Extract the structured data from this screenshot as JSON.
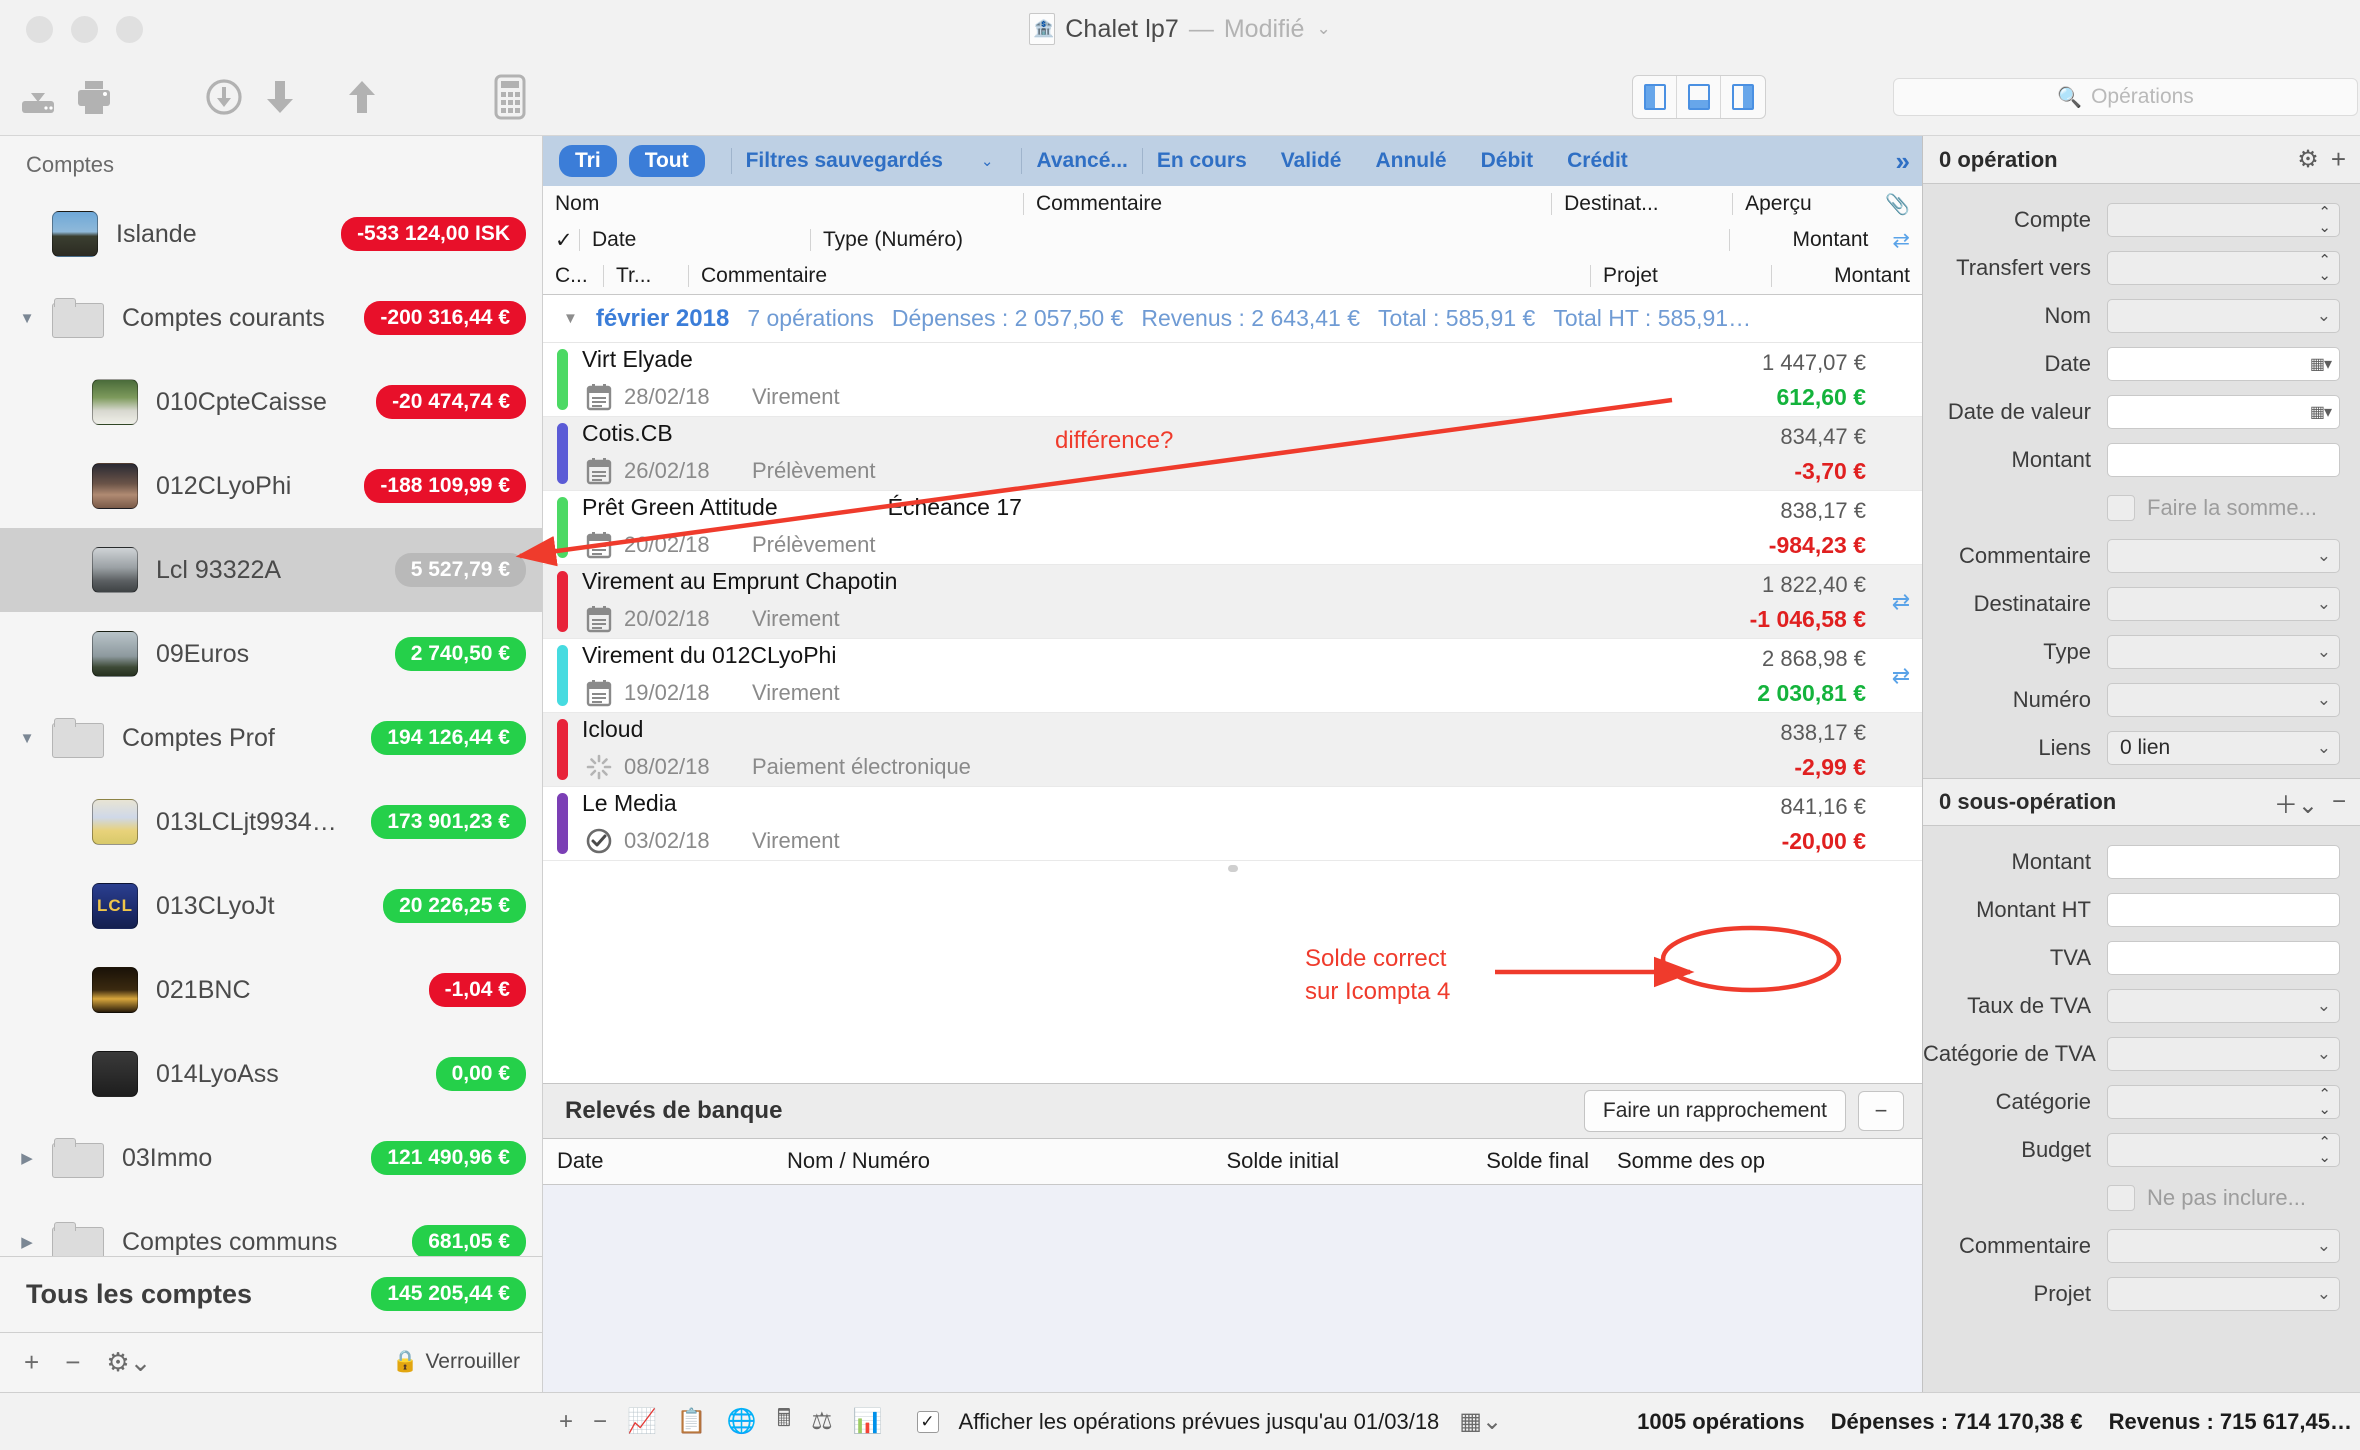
{
  "window": {
    "title": "Chalet lp7",
    "separator": "—",
    "modified": "Modifié",
    "doc_icon": "bank-document-icon"
  },
  "toolbar": {
    "buttons": [
      {
        "name": "import-icon",
        "label": "Importer"
      },
      {
        "name": "print-icon",
        "label": "Imprimer"
      },
      {
        "name": "download-circle-icon",
        "label": "Télécharger"
      },
      {
        "name": "arrow-down-icon",
        "label": "Descendre"
      },
      {
        "name": "arrow-up-icon",
        "label": "Monter"
      },
      {
        "name": "calculator-icon",
        "label": "Calculatrice"
      }
    ],
    "view_segments": [
      "layout-left-icon",
      "layout-bottom-icon",
      "layout-right-icon"
    ],
    "search_placeholder": "Opérations",
    "search_value": ""
  },
  "sidebar": {
    "header": "Comptes",
    "items": [
      {
        "name": "Islande",
        "badge": "-533 124,00 ISK",
        "tone": "neg",
        "kind": "account",
        "level": 0,
        "thumb": "t-islande",
        "disclosure": ""
      },
      {
        "name": "Comptes courants",
        "badge": "-200 316,44 €",
        "tone": "neg",
        "kind": "folder",
        "level": 0,
        "thumb": "",
        "disclosure": "▼"
      },
      {
        "name": "010CpteCaisse",
        "badge": "-20 474,74 €",
        "tone": "neg",
        "kind": "account",
        "level": 1,
        "thumb": "t-caisse",
        "disclosure": ""
      },
      {
        "name": "012CLyoPhi",
        "badge": "-188 109,99 €",
        "tone": "neg",
        "kind": "account",
        "level": 1,
        "thumb": "t-lyophi",
        "disclosure": ""
      },
      {
        "name": "Lcl 93322A",
        "badge": "5 527,79 €",
        "tone": "grey",
        "kind": "account",
        "level": 1,
        "thumb": "t-lcl93",
        "disclosure": "",
        "selected": true
      },
      {
        "name": "09Euros",
        "badge": "2 740,50 €",
        "tone": "pos",
        "kind": "account",
        "level": 1,
        "thumb": "t-09euros",
        "disclosure": ""
      },
      {
        "name": "Comptes Prof",
        "badge": "194 126,44 €",
        "tone": "pos",
        "kind": "folder",
        "level": 0,
        "thumb": "",
        "disclosure": "▼"
      },
      {
        "name": "013LCLjt9934…",
        "badge": "173 901,23 €",
        "tone": "pos",
        "kind": "account",
        "level": 1,
        "thumb": "t-013lcl",
        "disclosure": ""
      },
      {
        "name": "013CLyoJt",
        "badge": "20 226,25 €",
        "tone": "pos",
        "kind": "account",
        "level": 1,
        "thumb": "t-lcl",
        "disclosure": ""
      },
      {
        "name": "021BNC",
        "badge": "-1,04 €",
        "tone": "neg",
        "kind": "account",
        "level": 1,
        "thumb": "t-021bnc",
        "disclosure": ""
      },
      {
        "name": "014LyoAss",
        "badge": "0,00 €",
        "tone": "pos",
        "kind": "account",
        "level": 1,
        "thumb": "t-014lyo",
        "disclosure": ""
      },
      {
        "name": "03Immo",
        "badge": "121 490,96 €",
        "tone": "pos",
        "kind": "folder",
        "level": 0,
        "thumb": "",
        "disclosure": "▶"
      },
      {
        "name": "Comptes communs",
        "badge": "681,05 €",
        "tone": "pos",
        "kind": "folder",
        "level": 0,
        "thumb": "",
        "disclosure": "▶"
      }
    ],
    "total_label": "Tous les comptes",
    "total_badge": "145 205,44 €",
    "footer": {
      "add": "+",
      "remove": "−",
      "gear": "gear-icon",
      "lock_label": "Verrouiller"
    }
  },
  "filterbar": {
    "sort_pill": "Tri",
    "all_pill": "Tout",
    "saved_filters": "Filtres sauvegardés",
    "advanced": "Avancé...",
    "tabs": [
      "En cours",
      "Validé",
      "Annulé",
      "Débit",
      "Crédit"
    ],
    "expand": "»"
  },
  "columns": {
    "row1": [
      "Nom",
      "Commentaire",
      "Destinat...",
      "Aperçu"
    ],
    "row2": [
      "✓",
      "Date",
      "Type (Numéro)",
      "Montant"
    ],
    "row3": [
      "C...",
      "Tr...",
      "Commentaire",
      "Projet",
      "Montant"
    ],
    "attachment_icon": "paperclip-icon",
    "transfer_icon": "transfer-arrows-icon"
  },
  "month_group": {
    "triangle": "▼",
    "name": "février 2018",
    "count": "7 opérations",
    "expenses": "Dépenses : 2 057,50 €",
    "revenue": "Revenus : 2 643,41 €",
    "total": "Total : 585,91 €",
    "total_ht": "Total HT : 585,91…"
  },
  "transactions": [
    {
      "name": "Virt Elyade",
      "comment": "",
      "date": "28/02/18",
      "type": "Virement",
      "balance": "1 447,07 €",
      "amount": "612,60 €",
      "sign": "pos",
      "bar": "#4cd964",
      "status": "calendar-icon",
      "transfer": false,
      "alt": false
    },
    {
      "name": "Cotis.CB",
      "comment": "",
      "date": "26/02/18",
      "type": "Prélèvement",
      "balance": "834,47 €",
      "amount": "-3,70 €",
      "sign": "neg",
      "bar": "#5b5bd6",
      "status": "calendar-icon",
      "transfer": false,
      "alt": true
    },
    {
      "name": "Prêt Green Attitude",
      "comment": "Échéance 17",
      "date": "20/02/18",
      "type": "Prélèvement",
      "balance": "838,17 €",
      "amount": "-984,23 €",
      "sign": "neg",
      "bar": "#4cd964",
      "status": "calendar-icon",
      "transfer": false,
      "alt": false
    },
    {
      "name": "Virement au Emprunt Chapotin",
      "comment": "",
      "date": "20/02/18",
      "type": "Virement",
      "balance": "1 822,40 €",
      "amount": "-1 046,58 €",
      "sign": "neg",
      "bar": "#e8233a",
      "status": "calendar-icon",
      "transfer": true,
      "alt": true
    },
    {
      "name": "Virement du 012CLyoPhi",
      "comment": "",
      "date": "19/02/18",
      "type": "Virement",
      "balance": "2 868,98 €",
      "amount": "2 030,81 €",
      "sign": "pos",
      "bar": "#46dbe0",
      "status": "calendar-icon",
      "transfer": true,
      "alt": false
    },
    {
      "name": "Icloud",
      "comment": "",
      "date": "08/02/18",
      "type": "Paiement électronique",
      "balance": "838,17 €",
      "amount": "-2,99 €",
      "sign": "neg",
      "bar": "#e8233a",
      "status": "spinner-icon",
      "transfer": false,
      "alt": true
    },
    {
      "name": "Le Media",
      "comment": "",
      "date": "03/02/18",
      "type": "Virement",
      "balance": "841,16 €",
      "amount": "-20,00 €",
      "sign": "neg",
      "bar": "#7b3fb5",
      "status": "check-icon",
      "transfer": false,
      "alt": false
    }
  ],
  "releves": {
    "title": "Relevés de banque",
    "reconcile_button": "Faire un rapprochement",
    "minus_button": "−",
    "columns": [
      "Date",
      "Nom / Numéro",
      "Solde initial",
      "Solde final",
      "Somme des op"
    ]
  },
  "inspector": {
    "header": "0 opération",
    "gear": "gear-icon",
    "add": "+",
    "fields": [
      {
        "label": "Compte",
        "value": "",
        "control": "stepper"
      },
      {
        "label": "Transfert vers",
        "value": "",
        "control": "stepper"
      },
      {
        "label": "Nom",
        "value": "",
        "control": "chevron"
      },
      {
        "label": "Date",
        "value": "",
        "control": "calendar"
      },
      {
        "label": "Date de valeur",
        "value": "",
        "control": "calendar"
      },
      {
        "label": "Montant",
        "value": "",
        "control": "plain"
      }
    ],
    "checkbox_label": "Faire la somme...",
    "fields2": [
      {
        "label": "Commentaire",
        "value": "",
        "control": "chevron"
      },
      {
        "label": "Destinataire",
        "value": "",
        "control": "chevron"
      },
      {
        "label": "Type",
        "value": "",
        "control": "chevron"
      },
      {
        "label": "Numéro",
        "value": "",
        "control": "chevron"
      },
      {
        "label": "Liens",
        "value": "0 lien",
        "control": "chevron"
      }
    ],
    "sub_header": "0 sous-opération",
    "sub_add": "+",
    "sub_remove": "−",
    "sub_fields": [
      {
        "label": "Montant",
        "value": "",
        "control": "plain"
      },
      {
        "label": "Montant HT",
        "value": "",
        "control": "plain"
      },
      {
        "label": "TVA",
        "value": "",
        "control": "plain"
      },
      {
        "label": "Taux de TVA",
        "value": "",
        "control": "chevron"
      },
      {
        "label": "Catégorie de TVA",
        "value": "",
        "control": "chevron"
      },
      {
        "label": "Catégorie",
        "value": "",
        "control": "stepper"
      },
      {
        "label": "Budget",
        "value": "",
        "control": "stepper"
      }
    ],
    "sub_checkbox_label": "Ne pas inclure...",
    "sub_fields2": [
      {
        "label": "Commentaire",
        "value": "",
        "control": "chevron"
      },
      {
        "label": "Projet",
        "value": "",
        "control": "chevron"
      }
    ]
  },
  "statusbar": {
    "add": "+",
    "remove": "−",
    "icons": [
      "chart-line-icon",
      "clipboard-icon",
      "globe-icon",
      "calculator-icon",
      "scale-icon",
      "bar-chart-icon"
    ],
    "checkbox_checked": true,
    "checkbox_label": "Afficher les opérations prévues jusqu'au 01/03/18",
    "grid_icon": "grid-icon",
    "op_count": "1005 opérations",
    "expenses": "Dépenses : 714 170,38 €",
    "revenue": "Revenus : 715 617,45…"
  },
  "annotations": [
    {
      "text": "différence?",
      "name": "annotation-difference"
    },
    {
      "text": "Solde correct",
      "name": "annotation-solde-line1"
    },
    {
      "text": "sur Icompta 4",
      "name": "annotation-solde-line2"
    }
  ],
  "colors": {
    "accent_blue": "#3b7dd8",
    "badge_negative": "#e8102a",
    "badge_positive": "#25d04a",
    "annotation_red": "#ef3b2c",
    "amount_negative": "#e02020",
    "amount_positive": "#14b33c"
  }
}
